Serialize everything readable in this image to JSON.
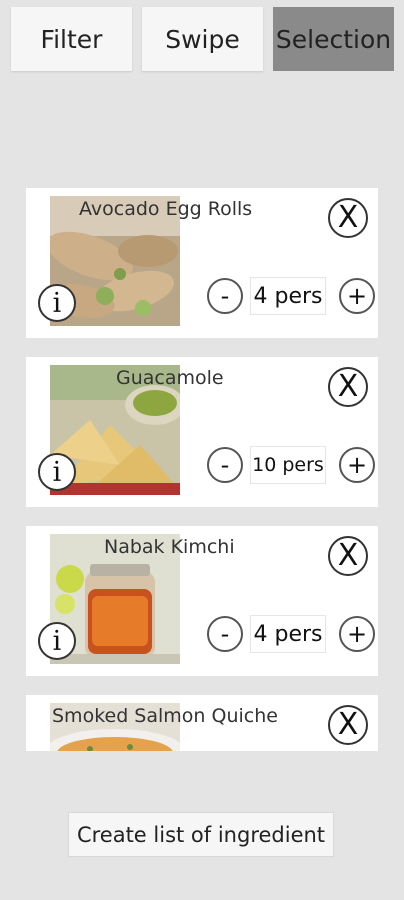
{
  "tabs": {
    "filter": "Filter",
    "swipe": "Swipe",
    "selection": "Selection"
  },
  "recipes": [
    {
      "title": "Avocado Egg Rolls",
      "quantity": "4 pers"
    },
    {
      "title": "Guacamole",
      "quantity": "10 pers"
    },
    {
      "title": "Nabak Kimchi",
      "quantity": "4 pers"
    },
    {
      "title": "Smoked Salmon Quiche",
      "quantity": ""
    }
  ],
  "controls": {
    "info_label": "i",
    "close_label": "X",
    "minus_label": "-",
    "plus_label": "+"
  },
  "footer": {
    "create_button_label": "Create list of ingredient"
  },
  "colors": {
    "background": "#e4e4e4",
    "active_tab": "#8a8a8a",
    "tab": "#f6f6f6",
    "card": "#ffffff"
  }
}
